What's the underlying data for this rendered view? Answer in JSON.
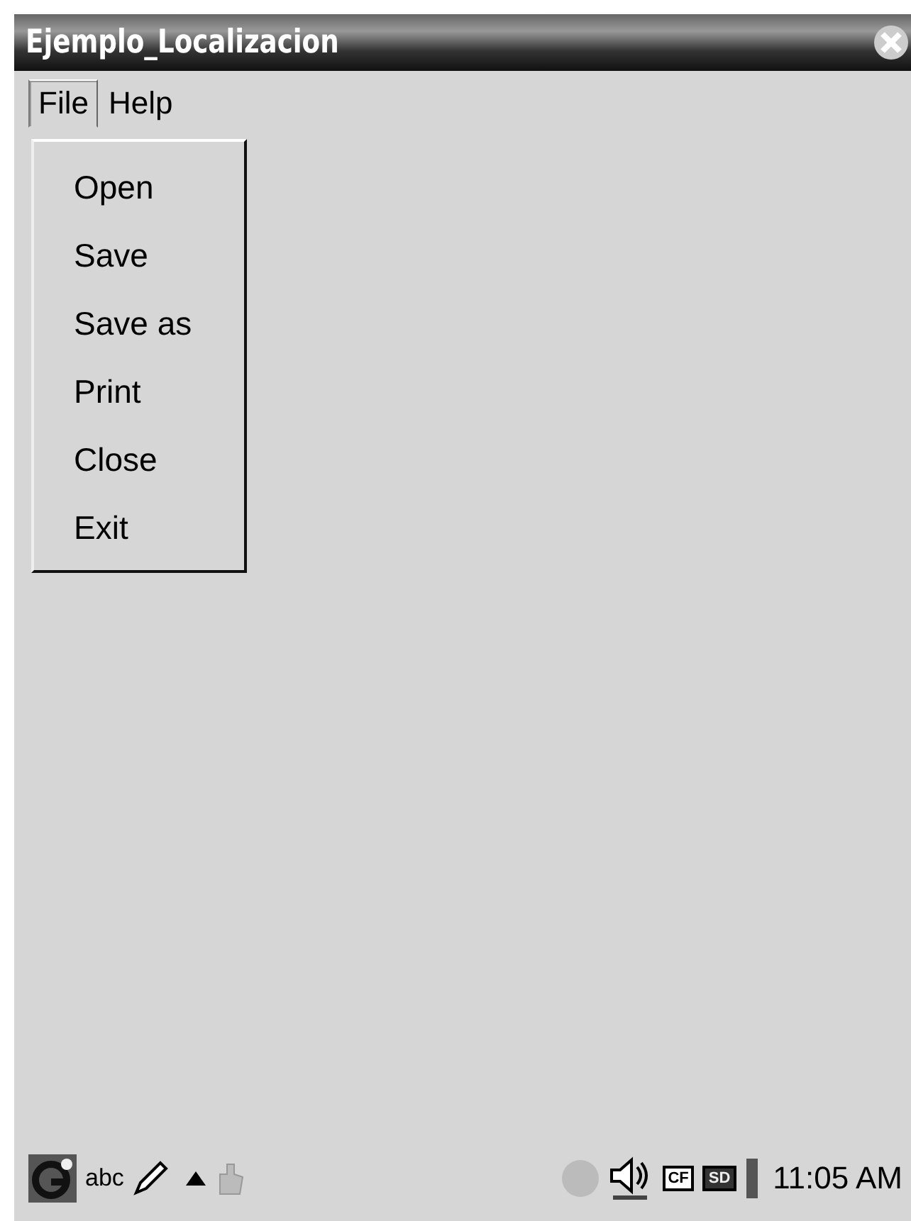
{
  "window": {
    "title": "Ejemplo_Localizacion"
  },
  "menu_bar": [
    {
      "label": "File",
      "selected": true
    },
    {
      "label": "Help",
      "selected": false
    }
  ],
  "dropdown": [
    "Open",
    "Save",
    "Save as",
    "Print",
    "Close",
    "Exit"
  ],
  "taskbar": {
    "input_method": "abc",
    "storage_cards": [
      "CF",
      "SD"
    ],
    "clock": "11:05 AM"
  }
}
